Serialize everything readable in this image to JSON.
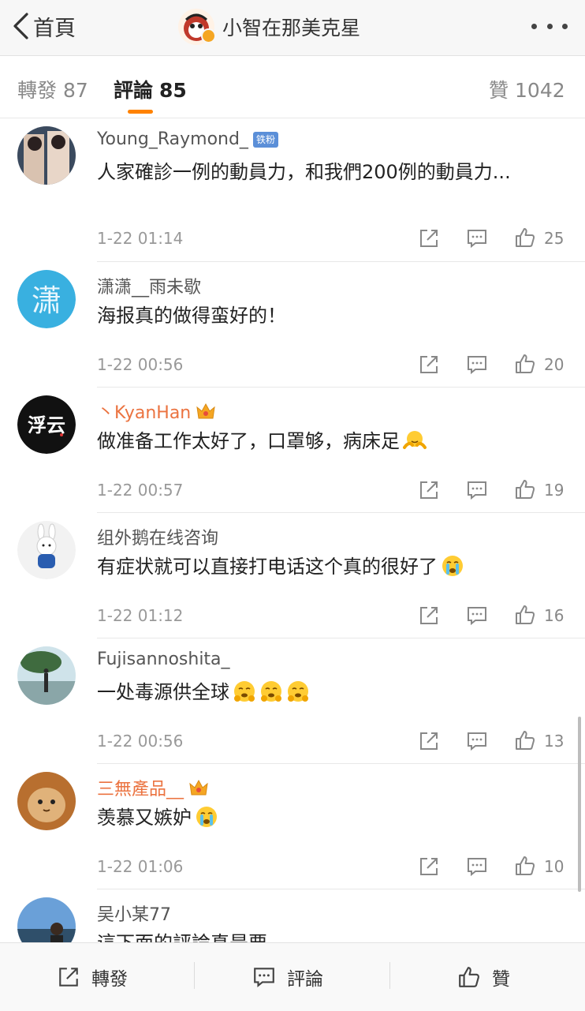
{
  "nav": {
    "back_label": "首頁",
    "title": "小智在那美克星",
    "more_icon": "more-icon"
  },
  "tabs": {
    "reposts": {
      "label": "轉發",
      "count": "87"
    },
    "comments": {
      "label": "評論",
      "count": "85"
    },
    "likes": {
      "label": "贊",
      "count": "1042"
    },
    "accent_color": "#ff8200"
  },
  "comments": [
    {
      "user": "Young_Raymond_",
      "badge": "铁粉",
      "text": "人家確診一例的動員力，和我們200例的動員力...",
      "time": "1-22 01:14",
      "likes": "25"
    },
    {
      "user": "潇潇__雨未歇",
      "text": "海报真的做得蛮好的！",
      "time": "1-22 00:56",
      "likes": "20"
    },
    {
      "user": "丶KyanHan",
      "text": "做准备工作太好了，口罩够，病床足",
      "time": "1-22 00:57",
      "likes": "19"
    },
    {
      "user": "组外鹅在线咨询",
      "text": "有症状就可以直接打电话这个真的很好了",
      "time": "1-22 01:12",
      "likes": "16"
    },
    {
      "user": "Fujisannoshita_",
      "text": "一处毒源供全球",
      "time": "1-22 00:56",
      "likes": "13"
    },
    {
      "user": "三無產品__",
      "text": "羡慕又嫉妒",
      "time": "1-22 01:06",
      "likes": "10"
    },
    {
      "user": "吴小某77",
      "text": "這下面的評論真是要",
      "time": "",
      "likes": ""
    }
  ],
  "bottom": {
    "repost_label": "轉發",
    "comment_label": "評論",
    "like_label": "贊"
  },
  "colors": {
    "vip_name": "#eb7340",
    "badge_blue": "#5b8fd8",
    "crown_gold": "#f5a623"
  }
}
